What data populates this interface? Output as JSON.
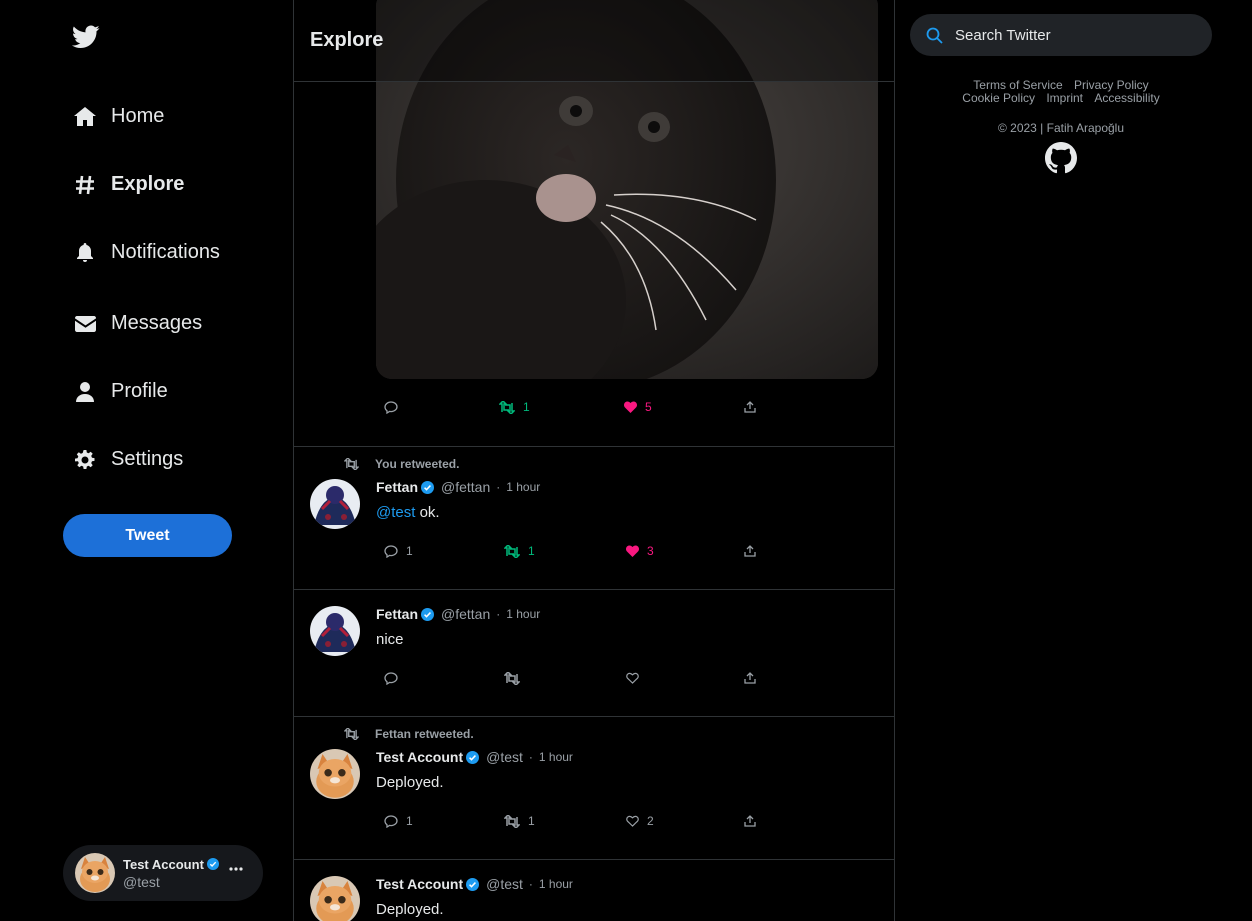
{
  "sidebar": {
    "nav": [
      {
        "label": "Home",
        "icon": "home-icon"
      },
      {
        "label": "Explore",
        "icon": "hashtag-icon"
      },
      {
        "label": "Notifications",
        "icon": "bell-icon"
      },
      {
        "label": "Messages",
        "icon": "envelope-icon"
      },
      {
        "label": "Profile",
        "icon": "user-icon"
      },
      {
        "label": "Settings",
        "icon": "gear-icon"
      }
    ],
    "tweet_button": "Tweet",
    "account": {
      "name": "Test Account",
      "handle": "@test"
    }
  },
  "header": {
    "title": "Explore"
  },
  "tweets": [
    {
      "media": "black-kitten-photo",
      "actions": {
        "reply": "",
        "retweet": "1",
        "like": "5"
      }
    },
    {
      "retweet_note": "You retweeted.",
      "name": "Fettan",
      "handle": "@fettan",
      "time": "1 hour",
      "mention": "@test",
      "text": " ok.",
      "actions": {
        "reply": "1",
        "retweet": "1",
        "like": "3"
      }
    },
    {
      "name": "Fettan",
      "handle": "@fettan",
      "time": "1 hour",
      "text": "nice",
      "actions": {
        "reply": "",
        "retweet": "",
        "like": ""
      }
    },
    {
      "retweet_note": "Fettan retweeted.",
      "name": "Test Account",
      "handle": "@test",
      "time": "1 hour",
      "text": "Deployed.",
      "actions": {
        "reply": "1",
        "retweet": "1",
        "like": "2"
      }
    },
    {
      "name": "Test Account",
      "handle": "@test",
      "time": "1 hour",
      "text": "Deployed."
    }
  ],
  "right": {
    "search_placeholder": "Search Twitter",
    "links": [
      "Terms of Service",
      "Privacy Policy",
      "Cookie Policy",
      "Imprint",
      "Accessibility"
    ],
    "copyright": "© 2023 | Fatih Arapoğlu"
  },
  "colors": {
    "accent": "#1d9bf0",
    "retweet": "#00ba7c",
    "like": "#f91880",
    "button": "#1d70d8"
  }
}
